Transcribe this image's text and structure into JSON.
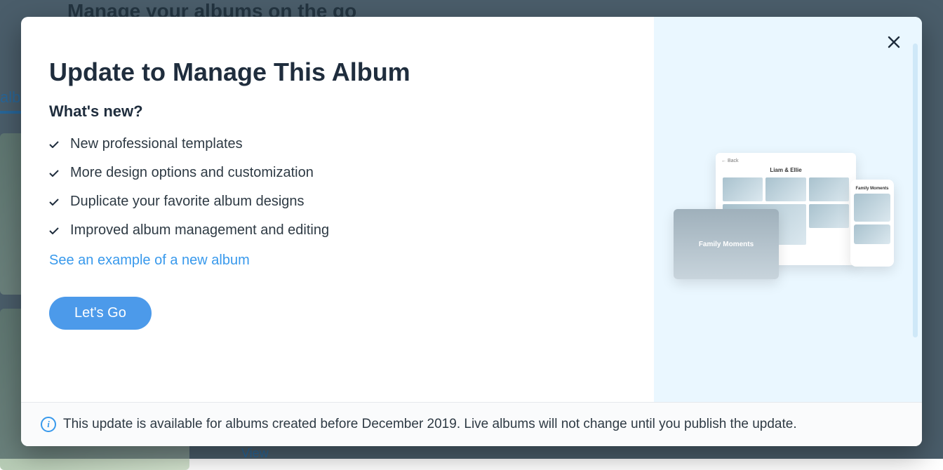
{
  "background": {
    "heading": "Manage your albums on the go",
    "tab": "alb",
    "view_label": "View"
  },
  "modal": {
    "title": "Update to Manage This Album",
    "subtitle": "What's new?",
    "features": [
      "New professional templates",
      "More design options and customization",
      "Duplicate your favorite album designs",
      "Improved album management and editing"
    ],
    "example_link": "See an example of a new album",
    "cta": "Let's Go",
    "preview": {
      "hero_label": "Family Moments",
      "grid_title": "Liam & Ellie",
      "grid_back": "← Back",
      "phone_title": "Family Moments"
    },
    "footer_notice": "This update is available for albums created before December 2019. Live albums will not change until you publish the update."
  }
}
